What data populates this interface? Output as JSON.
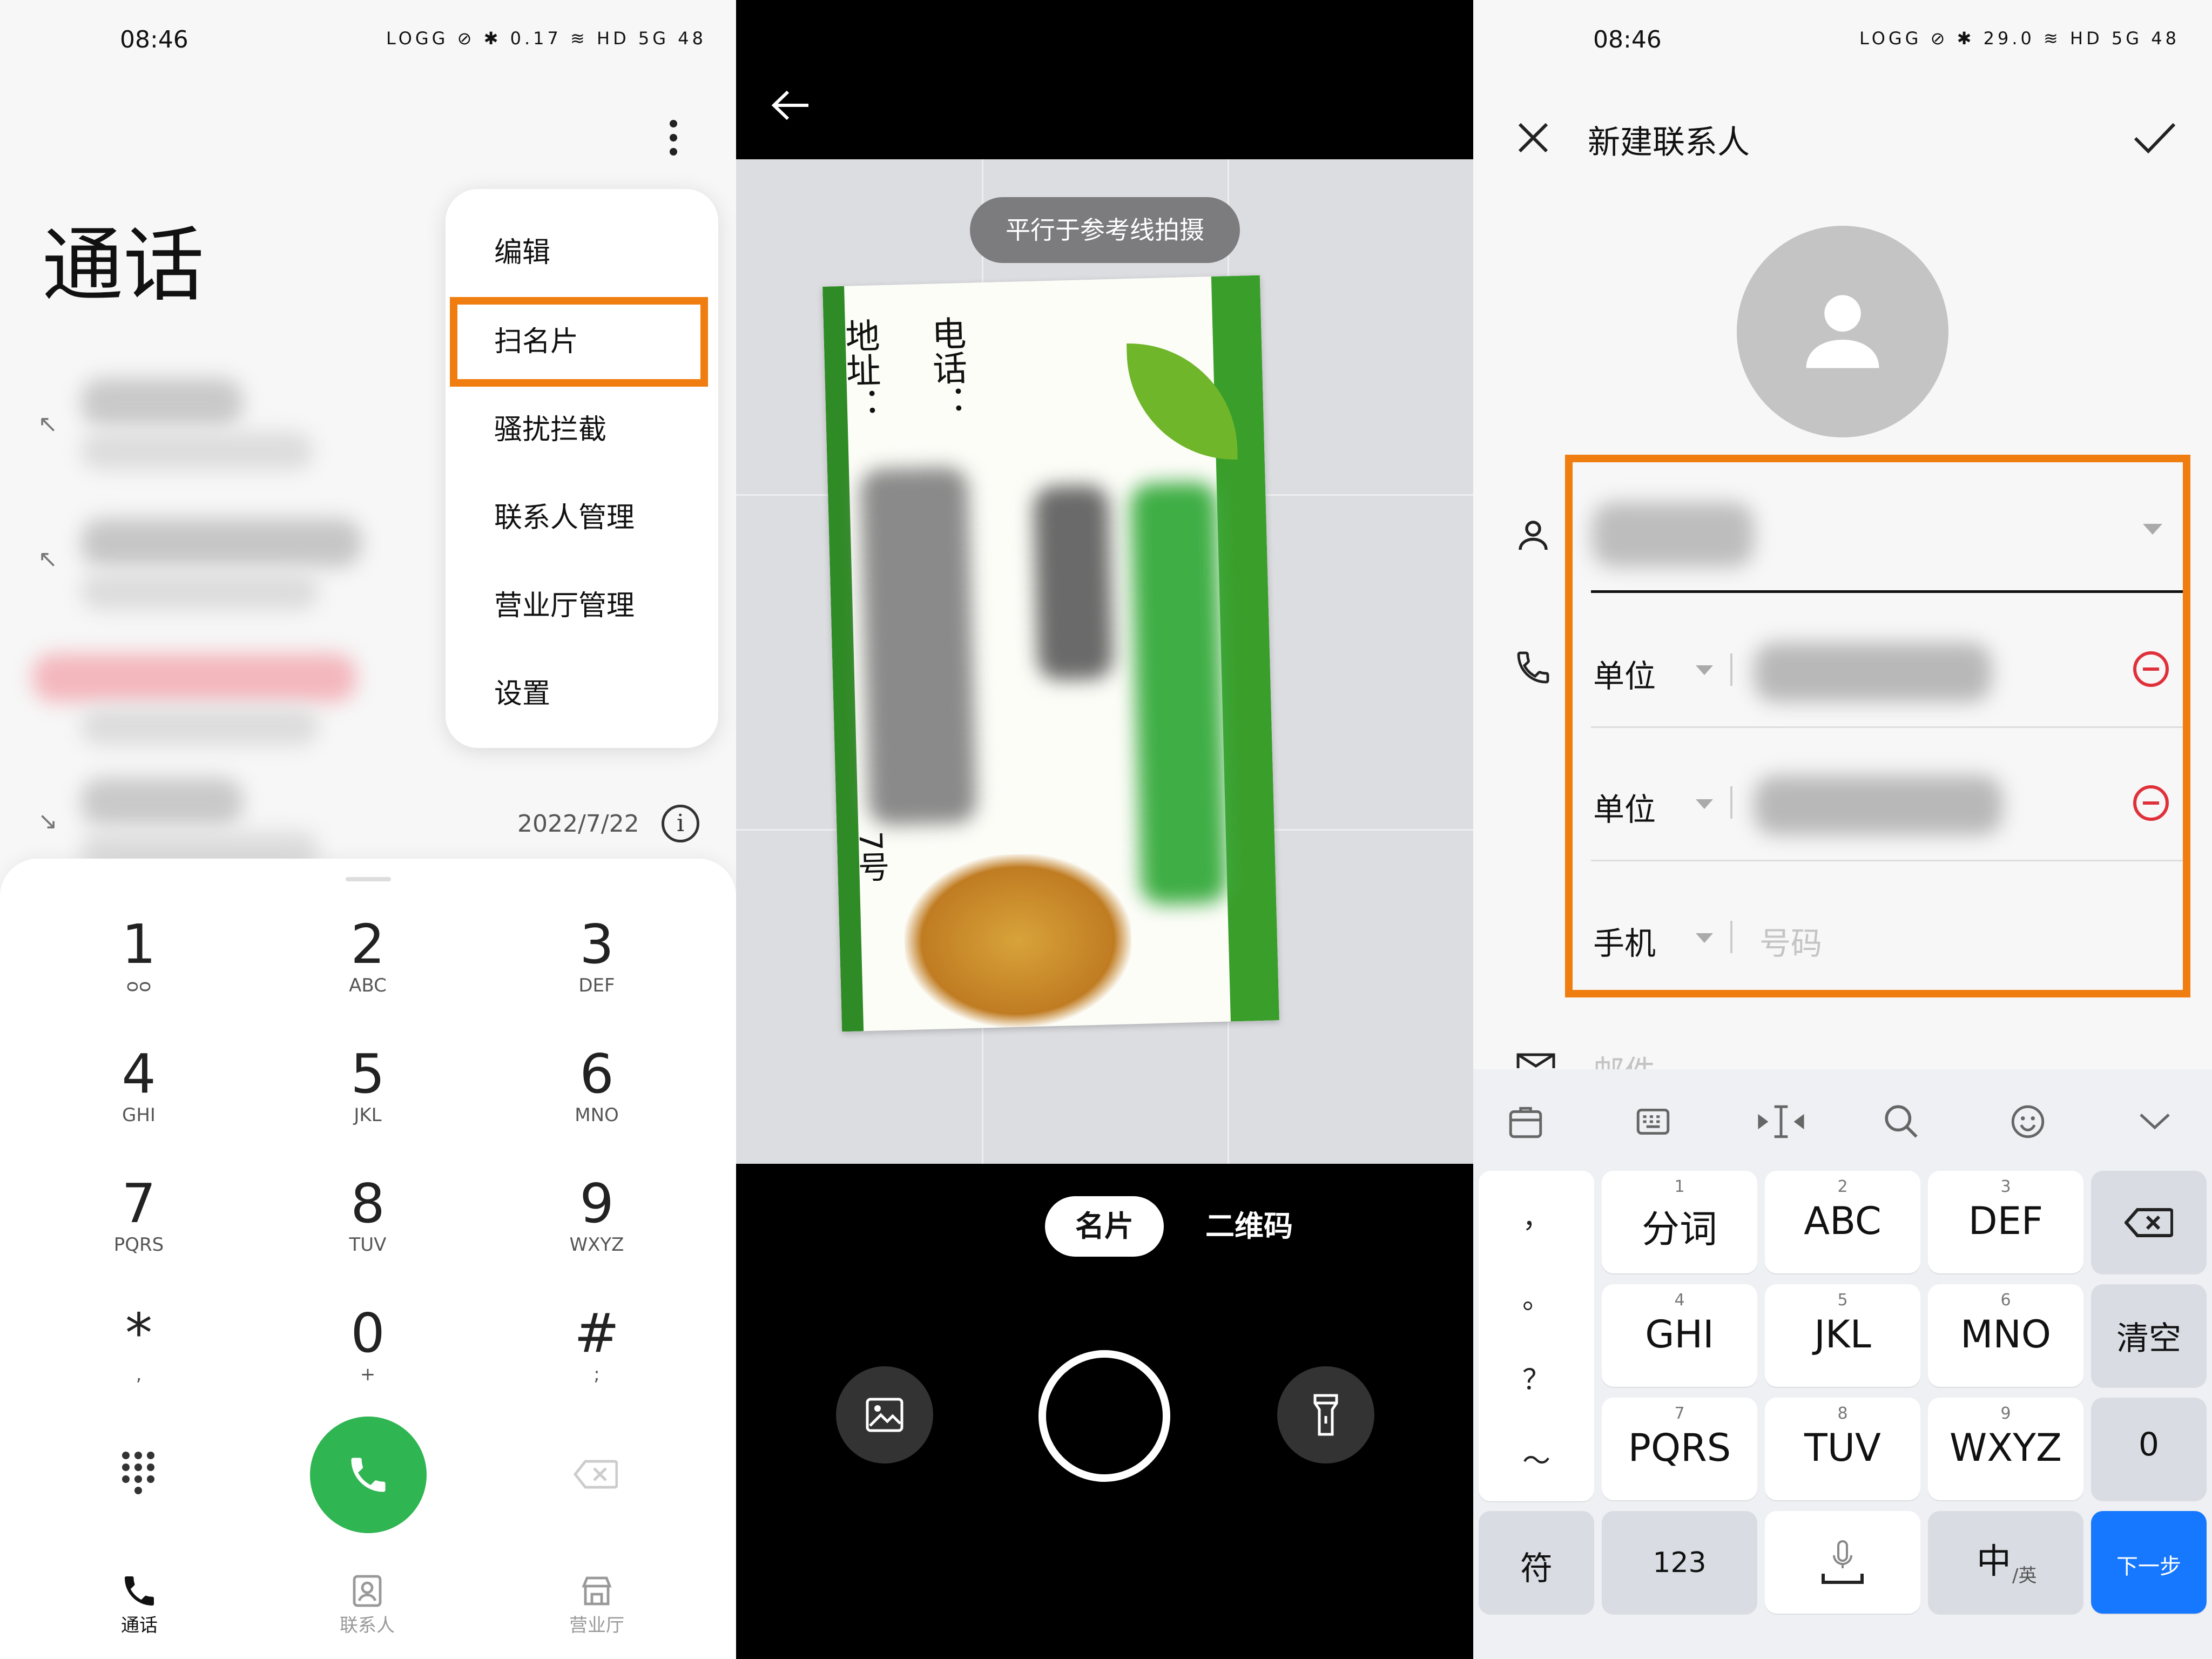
{
  "panel1": {
    "status": {
      "time": "08:46",
      "icons": "LOGG ⊘ ✱ 0.17 ≋ HD 5G 48"
    },
    "title": "通话",
    "menu": [
      "编辑",
      "扫名片",
      "骚扰拦截",
      "联系人管理",
      "营业厅管理",
      "设置"
    ],
    "last_call_date": "2022/7/22",
    "keypad": [
      {
        "num": "1",
        "sub": "ᴑᴑ"
      },
      {
        "num": "2",
        "sub": "ABC"
      },
      {
        "num": "3",
        "sub": "DEF"
      },
      {
        "num": "4",
        "sub": "GHI"
      },
      {
        "num": "5",
        "sub": "JKL"
      },
      {
        "num": "6",
        "sub": "MNO"
      },
      {
        "num": "7",
        "sub": "PQRS"
      },
      {
        "num": "8",
        "sub": "TUV"
      },
      {
        "num": "9",
        "sub": "WXYZ"
      },
      {
        "num": "*",
        "sub": ","
      },
      {
        "num": "0",
        "sub": "+"
      },
      {
        "num": "#",
        "sub": ";"
      }
    ],
    "tabs": [
      "通话",
      "联系人",
      "营业厅"
    ],
    "accent_green": "#2fb552",
    "highlight_color": "#f07d10"
  },
  "panel2": {
    "hint": "平行于参考线拍摄",
    "card_text": {
      "phone_label": "电话：",
      "address_label": "地址：",
      "tail": "7号"
    },
    "modes": [
      "名片",
      "二维码"
    ]
  },
  "panel3": {
    "status": {
      "time": "08:46",
      "icons": "LOGG ⊘ ✱ 29.0 ≋ HD 5G 48"
    },
    "title": "新建联系人",
    "fields": {
      "phone1_type": "单位",
      "phone2_type": "单位",
      "phone3_type": "手机",
      "phone3_placeholder": "号码",
      "email_placeholder": "邮件"
    },
    "keyboard": {
      "left_column": [
        "，",
        "。",
        "？",
        "～"
      ],
      "rows": [
        [
          {
            "small": "1",
            "main": "分词"
          },
          {
            "small": "2",
            "main": "ABC"
          },
          {
            "small": "3",
            "main": "DEF"
          }
        ],
        [
          {
            "small": "4",
            "main": "GHI"
          },
          {
            "small": "5",
            "main": "JKL"
          },
          {
            "small": "6",
            "main": "MNO"
          }
        ],
        [
          {
            "small": "7",
            "main": "PQRS"
          },
          {
            "small": "8",
            "main": "TUV"
          },
          {
            "small": "9",
            "main": "WXYZ"
          }
        ]
      ],
      "right_column": [
        "⌫",
        "清空",
        "0"
      ],
      "bottom": {
        "symbols": "符",
        "numbers": "123",
        "lang_main": "中",
        "lang_sub": "/英",
        "next": "下一步"
      },
      "next_color": "#1677ff"
    }
  }
}
